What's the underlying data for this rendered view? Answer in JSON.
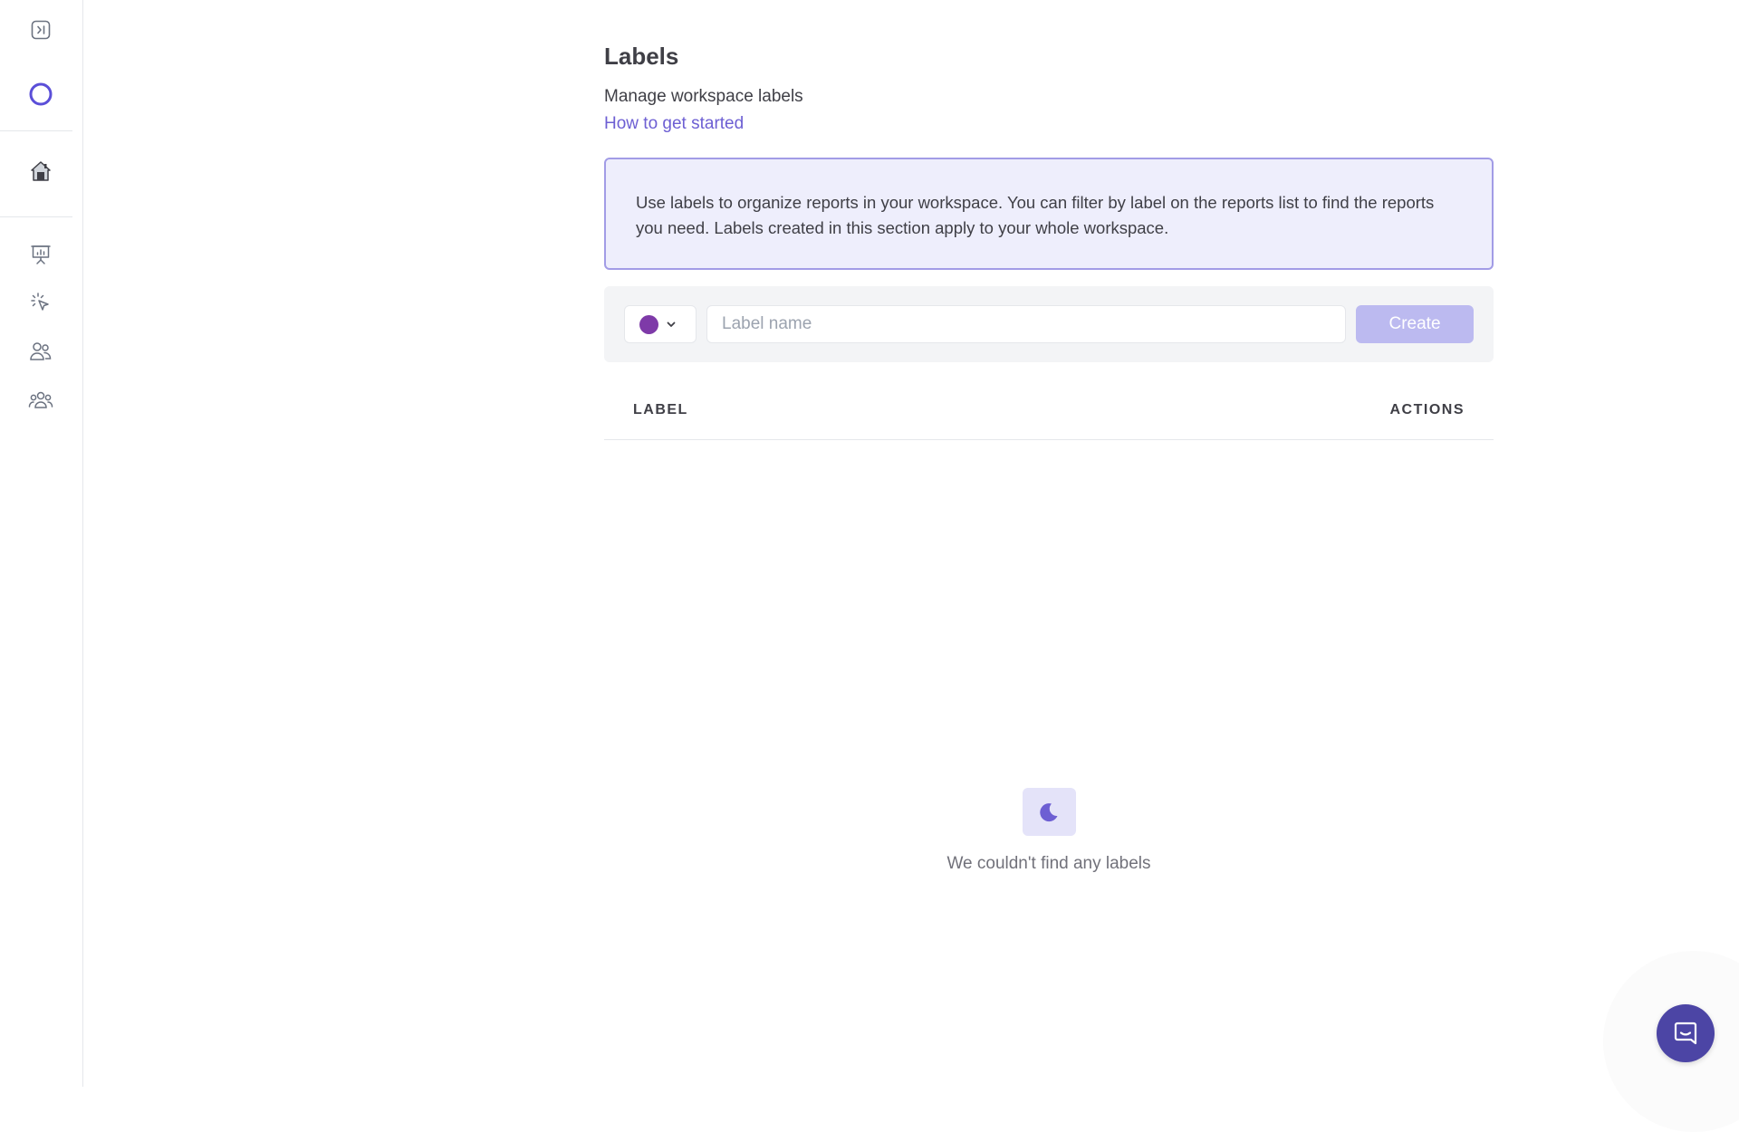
{
  "colors": {
    "accent": "#6d5fd3",
    "info_bg": "#eeeefc",
    "info_border": "#a29ce6",
    "selected_label_color": "#7e3aa8",
    "create_button_disabled": "#bcbaf0",
    "chat_button": "#4c45a5"
  },
  "sidebar": {
    "items": [
      {
        "name": "expand-sidebar",
        "icon": "sidebar-expand-icon"
      },
      {
        "name": "workspace-avatar",
        "icon": "circle-ring-icon"
      },
      {
        "name": "workspace-home",
        "icon": "house-icon"
      },
      {
        "name": "reports",
        "icon": "presentation-chart-icon"
      },
      {
        "name": "interactions",
        "icon": "cursor-click-icon"
      },
      {
        "name": "users",
        "icon": "users-icon"
      },
      {
        "name": "teams",
        "icon": "user-group-icon"
      }
    ]
  },
  "page": {
    "title": "Labels",
    "subtitle": "Manage workspace labels",
    "help_link": "How to get started"
  },
  "info": {
    "text": "Use labels to organize reports in your workspace. You can filter by label on the reports list to find the reports you need. Labels created in this section apply to your whole workspace."
  },
  "create_form": {
    "color_picker_icon": "chevron-down-icon",
    "name_value": "",
    "name_placeholder": "Label name",
    "create_label": "Create"
  },
  "table": {
    "columns": [
      "LABEL",
      "ACTIONS"
    ],
    "rows": []
  },
  "empty_state": {
    "icon": "moon-icon",
    "text": "We couldn't find any labels"
  },
  "chat": {
    "icon": "chat-bubble-icon"
  }
}
